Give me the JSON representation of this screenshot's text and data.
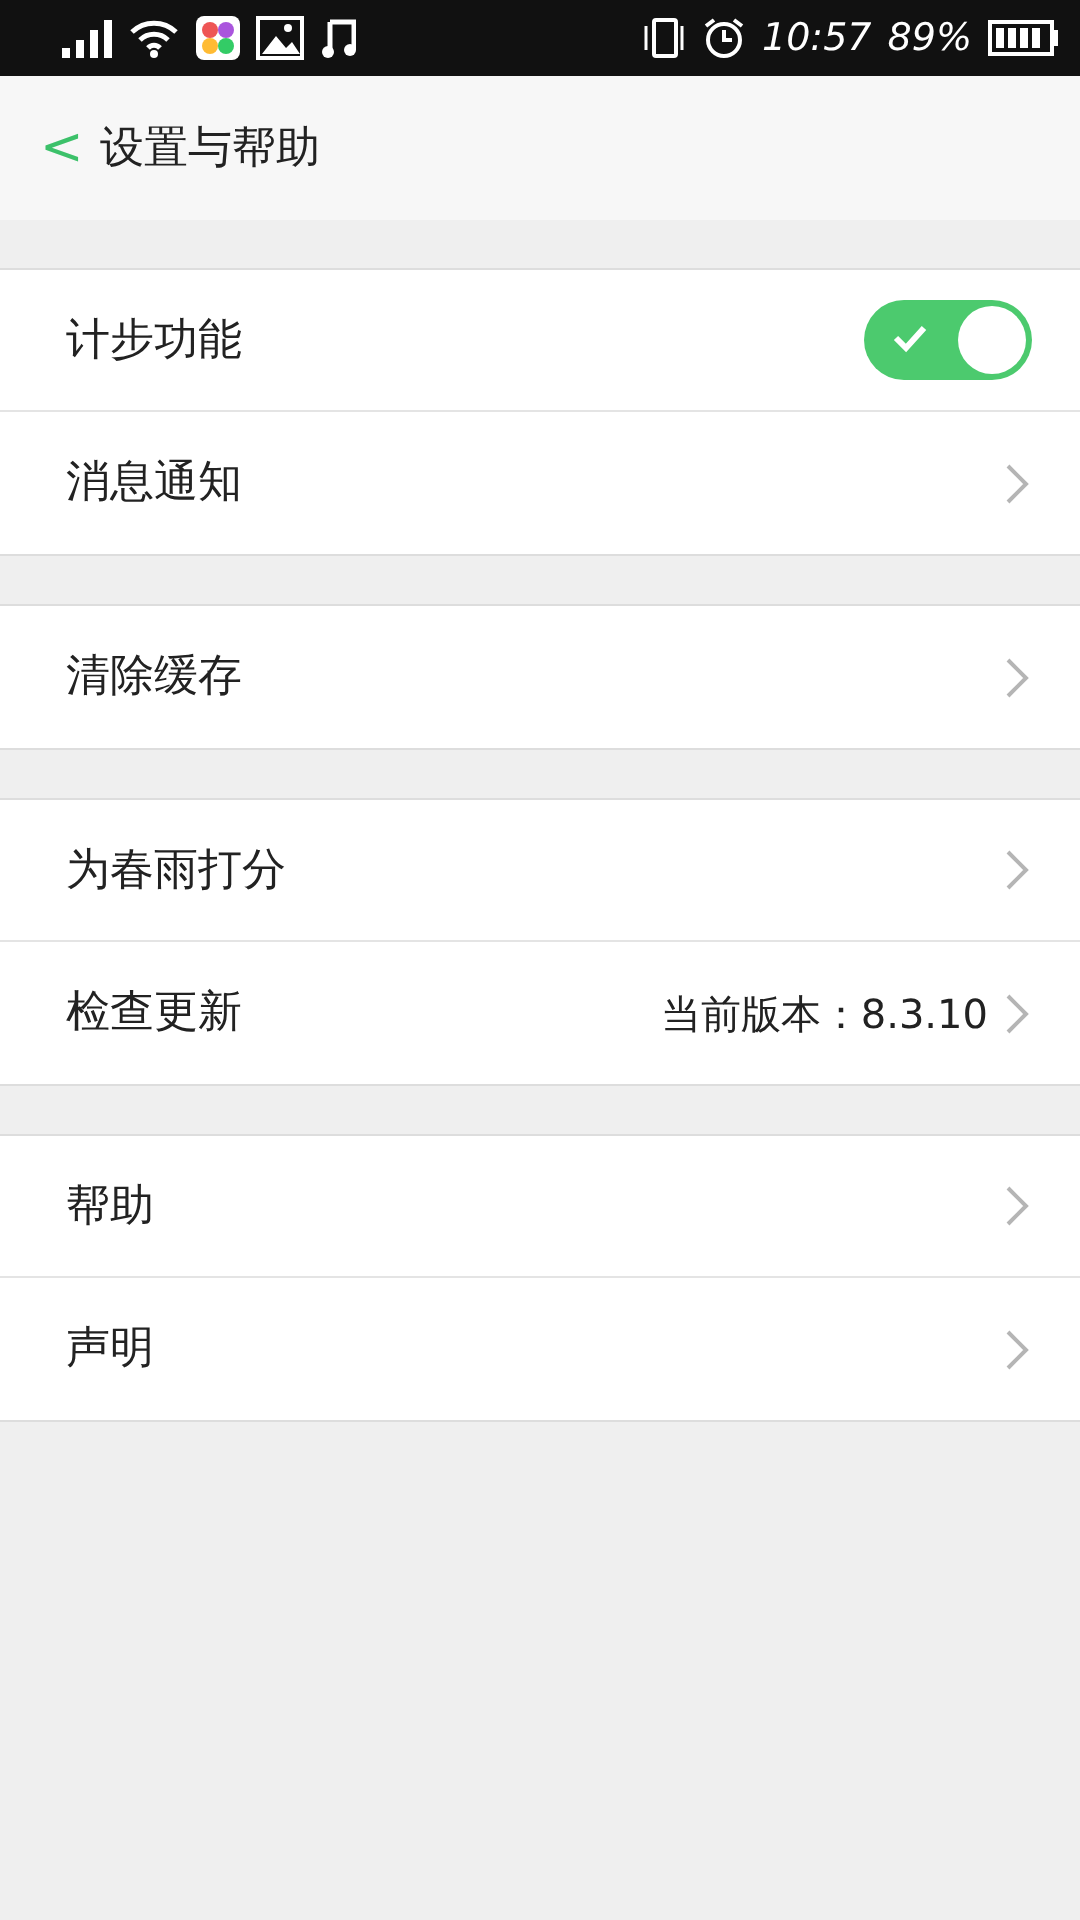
{
  "status_bar": {
    "time": "10:57",
    "battery": "89%"
  },
  "header": {
    "back": "<",
    "title": "设置与帮助"
  },
  "groups": [
    {
      "items": [
        {
          "kind": "toggle",
          "label": "计步功能",
          "on": true
        },
        {
          "kind": "link",
          "label": "消息通知"
        }
      ]
    },
    {
      "items": [
        {
          "kind": "link",
          "label": "清除缓存"
        }
      ]
    },
    {
      "items": [
        {
          "kind": "link",
          "label": "为春雨打分"
        },
        {
          "kind": "link",
          "label": "检查更新",
          "value": "当前版本：8.3.10"
        }
      ]
    },
    {
      "items": [
        {
          "kind": "link",
          "label": "帮助"
        },
        {
          "kind": "link",
          "label": "声明"
        }
      ]
    }
  ]
}
